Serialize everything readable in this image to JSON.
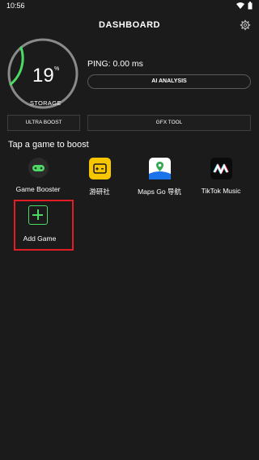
{
  "status": {
    "time": "10:56"
  },
  "header": {
    "title": "DASHBOARD"
  },
  "storage": {
    "value": "19",
    "unit": "%",
    "label": "STORAGE",
    "fraction": 0.19
  },
  "ping": {
    "text": "PING: 0.00 ms"
  },
  "buttons": {
    "ai_analysis": "AI ANALYSIS",
    "ultra_boost": "ULTRA BOOST",
    "gfx_tool": "GFX TOOL"
  },
  "section": {
    "title": "Tap a game to boost"
  },
  "games": [
    {
      "name": "Game Booster",
      "icon": "gamepad-icon"
    },
    {
      "name": "游研社",
      "icon": "youyanshe-icon"
    },
    {
      "name": "Maps Go 导航",
      "icon": "maps-icon"
    },
    {
      "name": "TikTok Music",
      "icon": "tiktok-music-icon"
    }
  ],
  "add_game": {
    "label": "Add Game",
    "icon": "plus-icon"
  },
  "colors": {
    "accent": "#4cd964",
    "highlight": "#e11d25",
    "background": "#1b1b1b"
  }
}
